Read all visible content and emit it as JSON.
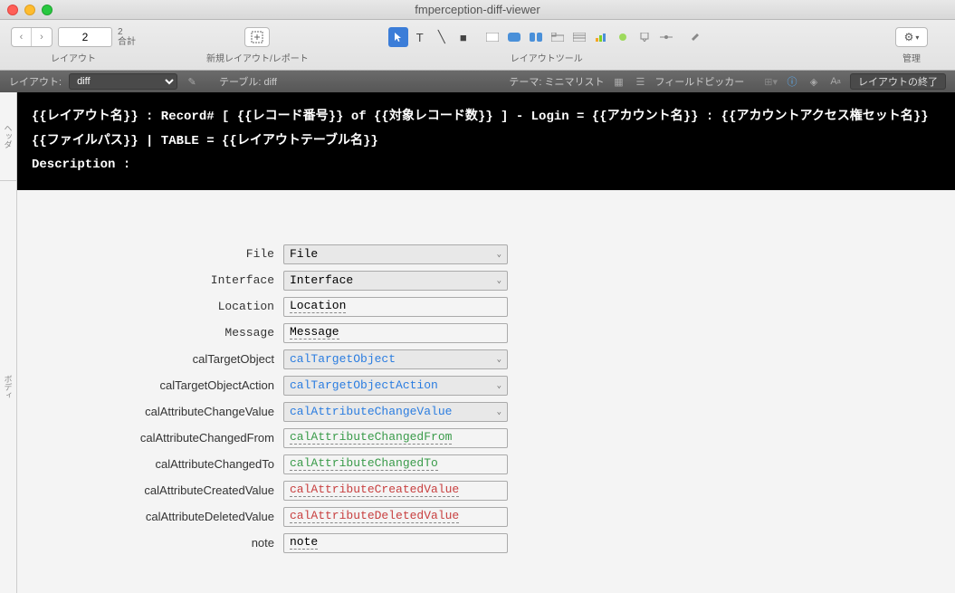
{
  "window": {
    "title": "fmperception-diff-viewer"
  },
  "toolbar": {
    "layout_value": "2",
    "layout_total": "2",
    "total_label": "合計",
    "layout_label": "レイアウト",
    "new_layout_label": "新規レイアウト/レポート",
    "tools_label": "レイアウトツール",
    "manage_label": "管理"
  },
  "subbar": {
    "layout_label": "レイアウト:",
    "layout_value": "diff",
    "table_label": "テーブル: diff",
    "theme_label": "テーマ: ミニマリスト",
    "field_picker": "フィールドピッカー",
    "exit_label": "レイアウトの終了"
  },
  "header": {
    "line1": "{{レイアウト名}} : Record# [ {{レコード番号}} of {{対象レコード数}} ] - Login = {{アカウント名}} : {{アカウントアクセス権セット名}}",
    "line2": "{{ファイルパス}} | TABLE = {{レイアウトテーブル名}}",
    "line3": "Description :"
  },
  "gutters": {
    "header": "ヘッダ",
    "body": "ボディ"
  },
  "fields": [
    {
      "label": "File",
      "value": "File",
      "mono": true,
      "dropdown": true,
      "color": "",
      "dotted": false
    },
    {
      "label": "Interface",
      "value": "Interface",
      "mono": true,
      "dropdown": true,
      "color": "",
      "dotted": false
    },
    {
      "label": "Location",
      "value": "Location",
      "mono": true,
      "dropdown": false,
      "color": "",
      "dotted": true
    },
    {
      "label": "Message",
      "value": "Message",
      "mono": true,
      "dropdown": false,
      "color": "",
      "dotted": true
    },
    {
      "label": "calTargetObject",
      "value": "calTargetObject",
      "mono": false,
      "dropdown": true,
      "color": "c-blue",
      "dotted": false
    },
    {
      "label": "calTargetObjectAction",
      "value": "calTargetObjectAction",
      "mono": false,
      "dropdown": true,
      "color": "c-blue",
      "dotted": false
    },
    {
      "label": "calAttributeChangeValue",
      "value": "calAttributeChangeValue",
      "mono": false,
      "dropdown": true,
      "color": "c-blue",
      "dotted": false
    },
    {
      "label": "calAttributeChangedFrom",
      "value": "calAttributeChangedFrom",
      "mono": false,
      "dropdown": false,
      "color": "c-green",
      "dotted": true
    },
    {
      "label": "calAttributeChangedTo",
      "value": "calAttributeChangedTo",
      "mono": false,
      "dropdown": false,
      "color": "c-green",
      "dotted": true
    },
    {
      "label": "calAttributeCreatedValue",
      "value": "calAttributeCreatedValue",
      "mono": false,
      "dropdown": false,
      "color": "c-red",
      "dotted": true
    },
    {
      "label": "calAttributeDeletedValue",
      "value": "calAttributeDeletedValue",
      "mono": false,
      "dropdown": false,
      "color": "c-red",
      "dotted": true
    },
    {
      "label": "note",
      "value": "note",
      "mono": false,
      "dropdown": false,
      "color": "",
      "dotted": true
    }
  ]
}
